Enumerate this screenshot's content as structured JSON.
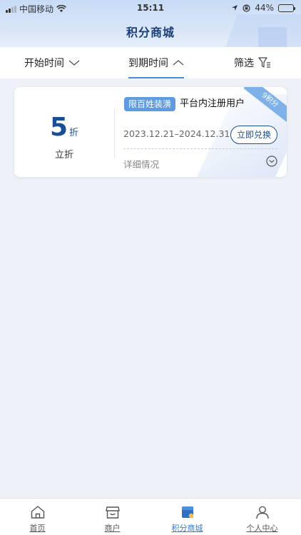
{
  "status_bar": {
    "carrier": "中国移动",
    "time": "15:11",
    "battery": "44%",
    "battery_level": 0.44
  },
  "header": {
    "title": "积分商城"
  },
  "filters": [
    {
      "label": "开始时间",
      "icon": "chevron-down-icon"
    },
    {
      "label": "到期时间",
      "icon": "chevron-up-icon",
      "active": true
    },
    {
      "label": "筛选",
      "icon": "filter-icon"
    }
  ],
  "coupons": [
    {
      "discount_value": "5",
      "discount_unit": "折",
      "discount_type": "立折",
      "tag": "限百姓装潢",
      "condition": "平台内注册用户",
      "points_badge": "9积分",
      "date_range": "2023.12.21–2024.12.31",
      "redeem_label": "立即兑换",
      "details_label": "详细情况"
    }
  ],
  "tabbar": [
    {
      "label": "首页",
      "icon": "home-icon"
    },
    {
      "label": "商户",
      "icon": "store-icon"
    },
    {
      "label": "积分商城",
      "icon": "points-mall-icon",
      "active": true
    },
    {
      "label": "个人中心",
      "icon": "user-icon"
    }
  ],
  "colors": {
    "accent": "#1a4f95",
    "tag_bg": "#5e9be0",
    "active_tab": "#3a7dd0"
  }
}
